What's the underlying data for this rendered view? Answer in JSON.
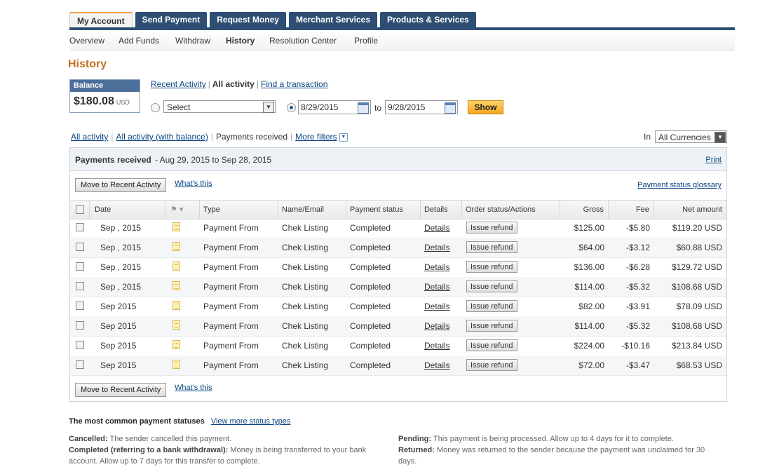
{
  "tabs": [
    "My Account",
    "Send Payment",
    "Request Money",
    "Merchant Services",
    "Products & Services"
  ],
  "subnav": [
    "Overview",
    "Add Funds",
    "Withdraw",
    "History",
    "Resolution Center",
    "Profile"
  ],
  "page_title": "History",
  "balance": {
    "label": "Balance",
    "amount": "$180.08",
    "currency": "USD"
  },
  "activity_links": {
    "recent": "Recent Activity",
    "all": "All activity",
    "find": "Find a transaction"
  },
  "filter_row": {
    "select_value": "Select",
    "from_date": "8/29/2015",
    "to_label": "to",
    "to_date": "9/28/2015",
    "show_label": "Show"
  },
  "view_links": {
    "all_activity": "All activity",
    "all_with_balance": "All activity (with balance)",
    "payments_received": "Payments received",
    "more_filters": "More filters"
  },
  "currency": {
    "label": "In",
    "value": "All Currencies"
  },
  "panel": {
    "title": "Payments received",
    "range": " - Aug 29, 2015 to Sep 28, 2015",
    "print": "Print",
    "move_label": "Move to Recent Activity",
    "whats_this": "What's this",
    "glossary": "Payment status glossary"
  },
  "columns": [
    "Date",
    "Type",
    "Name/Email",
    "Payment status",
    "Details",
    "Order status/Actions",
    "Gross",
    "Fee",
    "Net amount"
  ],
  "rows": [
    {
      "date": "Sep   , 2015",
      "type": "Payment From",
      "name": "Chek Listing",
      "status": "Completed",
      "details": "Details",
      "action": "Issue refund",
      "gross": "$125.00",
      "fee": "-$5.80",
      "net": "$119.20 USD"
    },
    {
      "date": "Sep   , 2015",
      "type": "Payment From",
      "name": "Chek Listing",
      "status": "Completed",
      "details": "Details",
      "action": "Issue refund",
      "gross": "$64.00",
      "fee": "-$3.12",
      "net": "$60.88 USD"
    },
    {
      "date": "Sep   , 2015",
      "type": "Payment From",
      "name": "Chek Listing",
      "status": "Completed",
      "details": "Details",
      "action": "Issue refund",
      "gross": "$136.00",
      "fee": "-$6.28",
      "net": "$129.72 USD"
    },
    {
      "date": "Sep   , 2015",
      "type": "Payment From",
      "name": "Chek Listing",
      "status": "Completed",
      "details": "Details",
      "action": "Issue refund",
      "gross": "$114.00",
      "fee": "-$5.32",
      "net": "$108.68 USD"
    },
    {
      "date": "Sep    2015",
      "type": "Payment From",
      "name": "Chek Listing",
      "status": "Completed",
      "details": "Details",
      "action": "Issue refund",
      "gross": "$82.00",
      "fee": "-$3.91",
      "net": "$78.09 USD"
    },
    {
      "date": "Sep    2015",
      "type": "Payment From",
      "name": "Chek Listing",
      "status": "Completed",
      "details": "Details",
      "action": "Issue refund",
      "gross": "$114.00",
      "fee": "-$5.32",
      "net": "$108.68 USD"
    },
    {
      "date": "Sep    2015",
      "type": "Payment From",
      "name": "Chek Listing",
      "status": "Completed",
      "details": "Details",
      "action": "Issue refund",
      "gross": "$224.00",
      "fee": "-$10.16",
      "net": "$213.84 USD"
    },
    {
      "date": "Sep    2015",
      "type": "Payment From",
      "name": "Chek Listing",
      "status": "Completed",
      "details": "Details",
      "action": "Issue refund",
      "gross": "$72.00",
      "fee": "-$3.47",
      "net": "$68.53 USD"
    }
  ],
  "statuses": {
    "title": "The most common payment statuses",
    "view_more": "View more status types",
    "cancelled_label": "Cancelled:",
    "cancelled_text": " The sender cancelled this payment.",
    "completed_label": "Completed (referring to a bank withdrawal):",
    "completed_text": " Money is being transferred to your bank account. Allow up to 7 days for this transfer to complete.",
    "pending_label": "Pending:",
    "pending_text": " This payment is being processed. Allow up to 4 days for it to complete.",
    "returned_label": "Returned:",
    "returned_text": " Money was returned to the sender because the payment was unclaimed for 30 days."
  }
}
